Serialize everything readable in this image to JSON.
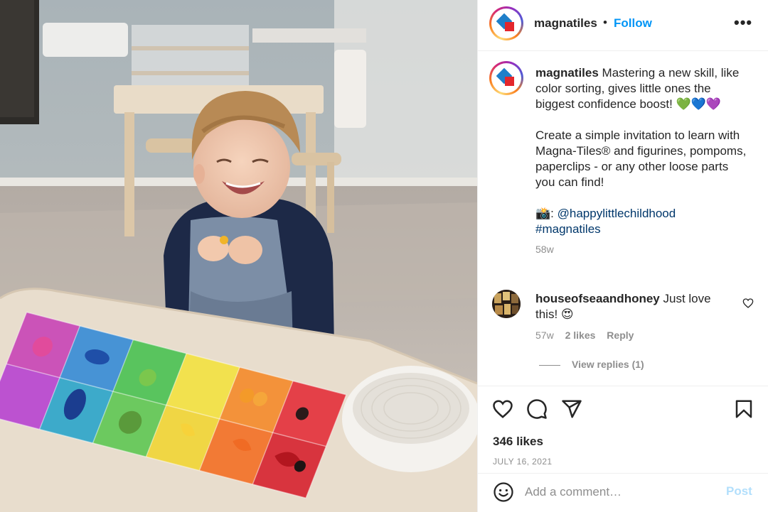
{
  "post": {
    "image": {
      "alt": ""
    },
    "header": {
      "username": "magnatiles",
      "separator": "•",
      "follow_label": "Follow",
      "more_icon": "more-options-icon"
    },
    "caption": {
      "username": "magnatiles",
      "line1": "Mastering a new skill, like color sorting, gives little ones the biggest confidence boost! 💚💙💜",
      "line2": "Create a simple invitation to learn with Magna-Tiles® and figurines, pompoms, paperclips - or any other loose parts you can find!",
      "camera_emoji": "📸:",
      "mention": "@happylittlechildhood",
      "hashtag": "#magnatiles",
      "age": "58w"
    },
    "comments": [
      {
        "username": "houseofseaandhoney",
        "text": "Just love this! 😍",
        "age": "57w",
        "likes": "2 likes",
        "reply_label": "Reply",
        "view_replies": "View replies (1)"
      }
    ],
    "actions": {
      "like_icon": "heart-icon",
      "comment_icon": "comment-bubble-icon",
      "share_icon": "paper-plane-icon",
      "save_icon": "bookmark-icon"
    },
    "likes_count": "346 likes",
    "date": "JULY 16, 2021",
    "add_comment": {
      "placeholder": "Add a comment…",
      "post_label": "Post"
    }
  },
  "colors": {
    "follow": "#0095f6",
    "link": "#00376b",
    "muted": "#8e8e8e",
    "post_disabled": "#b2dffc",
    "brand_blue": "#1f7fc9",
    "brand_red": "#e3262c"
  }
}
